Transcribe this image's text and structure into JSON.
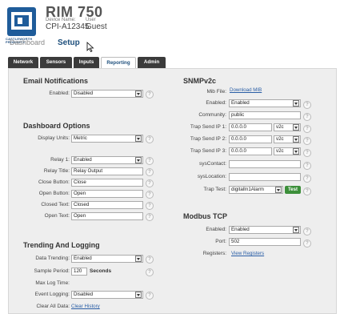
{
  "header": {
    "logo_text_1": "CASTLEWORTH",
    "logo_text_2": "PRODUCTS",
    "model": "RIM 750",
    "device_name_label": "Device Name:",
    "user_label": "User",
    "device_name": "CPI-A12345",
    "user": "Guest"
  },
  "nav": {
    "dashboard": "Dashboard",
    "setup": "Setup"
  },
  "tabs": [
    {
      "label": "Network"
    },
    {
      "label": "Sensors"
    },
    {
      "label": "Inputs"
    },
    {
      "label": "Reporting",
      "active": true
    },
    {
      "label": "Admin"
    }
  ],
  "email": {
    "title": "Email Notifications",
    "enabled_label": "Enabled:",
    "enabled_value": "Disabled"
  },
  "dashboard_options": {
    "title": "Dashboard Options",
    "display_units_label": "Display Units:",
    "display_units_value": "Metric",
    "relay1_label": "Relay 1:",
    "relay1_value": "Enabled",
    "relay_title_label": "Relay Title:",
    "relay_title_value": "Relay Output",
    "close_button_label": "Close Button:",
    "close_button_value": "Close",
    "open_button_label": "Open Button:",
    "open_button_value": "Open",
    "closed_text_label": "Closed Text:",
    "closed_text_value": "Closed",
    "open_text_label": "Open Text:",
    "open_text_value": "Open"
  },
  "trending": {
    "title": "Trending And Logging",
    "data_trending_label": "Data Trending:",
    "data_trending_value": "Enabled",
    "sample_period_label": "Sample Period:",
    "sample_period_value": "120",
    "sample_period_unit": "Seconds",
    "max_log_label": "Max Log Time:",
    "event_logging_label": "Event Logging:",
    "event_logging_value": "Disabled",
    "clear_all_label": "Clear All Data:",
    "clear_history_link": "Clear History"
  },
  "snmp": {
    "title": "SNMPv2c",
    "mib_label": "Mib File:",
    "mib_link": "Download MIB",
    "enabled_label": "Enabled:",
    "enabled_value": "Enabled",
    "community_label": "Community:",
    "community_value": "public",
    "trap1_label": "Trap Send IP 1:",
    "trap1_value": "0.0.0.0",
    "trap1_version": "v2c",
    "trap2_label": "Trap Send IP 2:",
    "trap2_value": "0.0.0.0",
    "trap2_version": "v2c",
    "trap3_label": "Trap Send IP 3:",
    "trap3_value": "0.0.0.0",
    "trap3_version": "v2c",
    "syscontact_label": "sysContact:",
    "syscontact_value": "",
    "syslocation_label": "sysLocation:",
    "syslocation_value": "",
    "trap_test_label": "Trap Test:",
    "trap_test_value": "digitalIn1Alarm",
    "test_button": "Test"
  },
  "modbus": {
    "title": "Modbus TCP",
    "enabled_label": "Enabled:",
    "enabled_value": "Enabled",
    "port_label": "Port:",
    "port_value": "502",
    "registers_label": "Registers:",
    "registers_link": "View Registers"
  },
  "help_glyph": "?",
  "colors": {
    "accent": "#1e4f7c",
    "tab_dark": "#3b3b3b",
    "test_green": "#3c8f3a",
    "link": "#2a5ea6"
  }
}
